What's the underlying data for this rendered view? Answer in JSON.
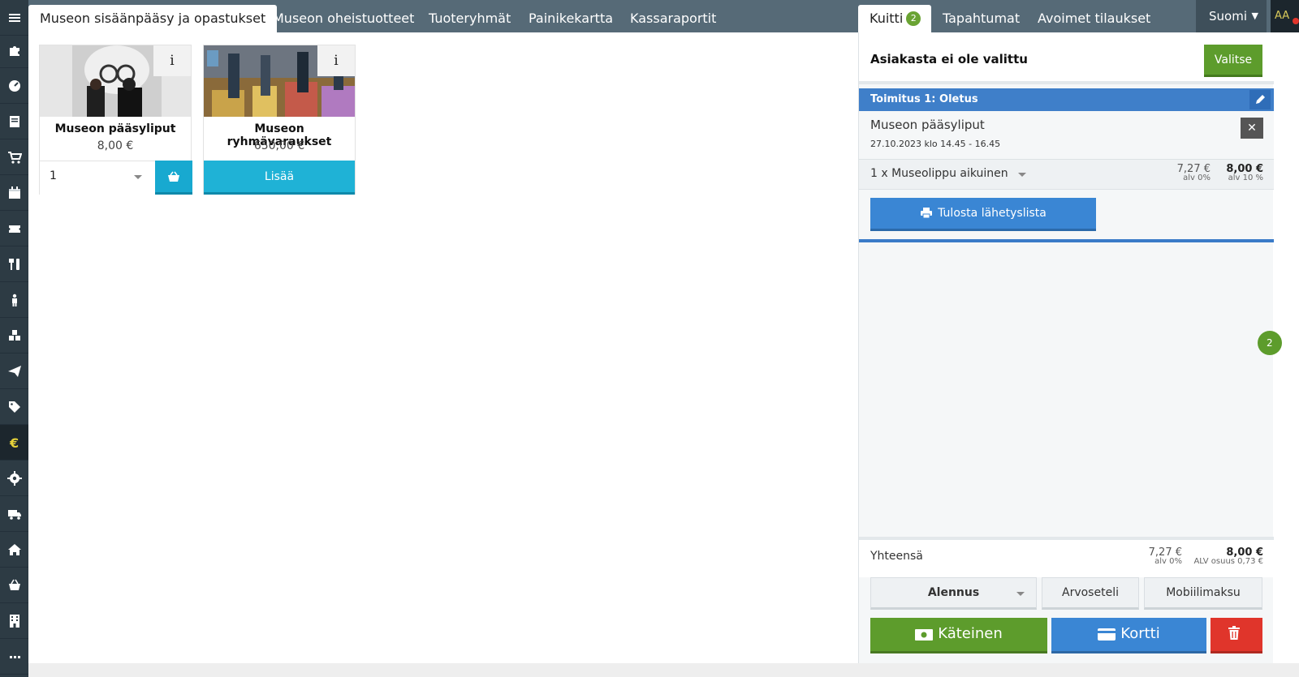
{
  "sidebar": {
    "items": [
      {
        "icon": "menu-icon",
        "active": false
      },
      {
        "icon": "puzzle-icon",
        "active": false
      },
      {
        "icon": "dashboard-icon",
        "active": false
      },
      {
        "icon": "book-icon",
        "active": false
      },
      {
        "icon": "cart-icon",
        "active": false
      },
      {
        "icon": "calendar-icon",
        "active": false
      },
      {
        "icon": "ticket-icon",
        "active": false
      },
      {
        "icon": "restaurant-icon",
        "active": false
      },
      {
        "icon": "person-icon",
        "active": false
      },
      {
        "icon": "cubes-icon",
        "active": false
      },
      {
        "icon": "paper-plane-icon",
        "active": false
      },
      {
        "icon": "tag-icon",
        "active": false
      },
      {
        "icon": "euro-icon",
        "active": true
      },
      {
        "icon": "gear-icon",
        "active": false
      },
      {
        "icon": "truck-icon",
        "active": false
      },
      {
        "icon": "home-icon",
        "active": false
      },
      {
        "icon": "basket-icon",
        "active": false
      },
      {
        "icon": "building-icon",
        "active": false
      }
    ]
  },
  "topbar": {
    "tabs": [
      {
        "label": "Museon sisäänpääsy ja opastukset",
        "active": true
      },
      {
        "label": "Museon oheistuotteet",
        "active": false
      },
      {
        "label": "Tuoteryhmät",
        "active": false
      },
      {
        "label": "Painikekartta",
        "active": false
      },
      {
        "label": "Kassaraportit",
        "active": false
      }
    ],
    "right_tabs": [
      {
        "label": "Kuitti",
        "badge": "2",
        "active": true
      },
      {
        "label": "Tapahtumat",
        "active": false
      },
      {
        "label": "Avoimet tilaukset",
        "active": false
      }
    ],
    "language": "Suomi",
    "user_initials": "AA"
  },
  "products": [
    {
      "name": "Museon pääsyliput",
      "price": "8,00 €",
      "info": "i",
      "quantity": "1",
      "action": "cart"
    },
    {
      "name": "Museon ryhmävaraukset",
      "price": "650,00 €",
      "info": "i",
      "action_label": "Lisää"
    }
  ],
  "receipt": {
    "customer_label": "Asiakasta ei ole valittu",
    "select_label": "Valitse",
    "delivery_label": "Toimitus 1: Oletus",
    "line": {
      "title": "Museon pääsyliput",
      "date": "27.10.2023 klo 14.45 - 16.45",
      "description": "1 x Museolippu aikuinen",
      "net": "7,27 €",
      "net_vat": "alv 0%",
      "gross": "8,00 €",
      "gross_vat": "alv 10 %"
    },
    "print_label": "Tulosta lähetyslista",
    "side_badge": "2",
    "total": {
      "label": "Yhteensä",
      "net": "7,27 €",
      "net_vat": "alv 0%",
      "gross": "8,00 €",
      "vat_share": "ALV osuus 0,73 €"
    },
    "buttons": {
      "discount": "Alennus",
      "voucher": "Arvoseteli",
      "mobile": "Mobiilimaksu",
      "cash": "Käteinen",
      "card": "Kortti"
    }
  },
  "colors": {
    "sidebar": "#2d3b44",
    "topbar": "#566a77",
    "accent_green": "#5d9c2c",
    "accent_blue": "#3a86d4",
    "accent_cyan": "#1fb2d6",
    "danger": "#e0352b",
    "active_euro": "#e6d23a"
  }
}
